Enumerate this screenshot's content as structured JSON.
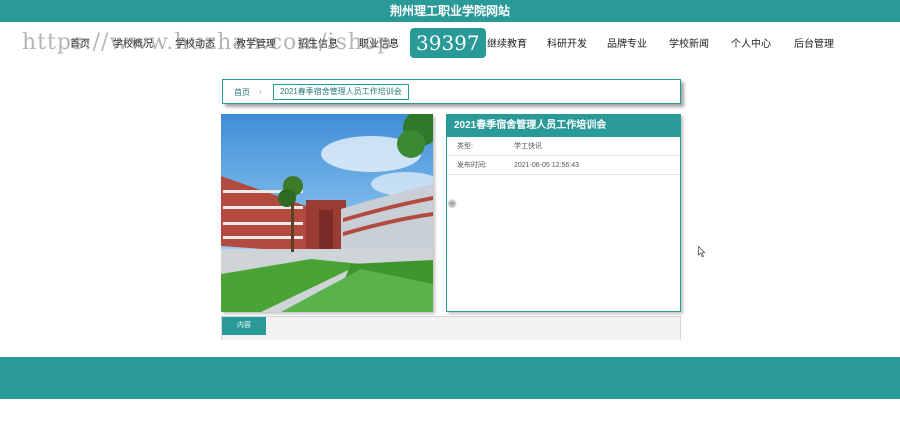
{
  "site": {
    "title": "荆州理工职业学院网站"
  },
  "nav": {
    "items": [
      {
        "label": "首页"
      },
      {
        "label": "学校概况"
      },
      {
        "label": "学校动态"
      },
      {
        "label": "教学管理"
      },
      {
        "label": "招生信息"
      },
      {
        "label": "职业信息"
      },
      {
        "label": "继续教育"
      },
      {
        "label": "科研开发"
      },
      {
        "label": "品牌专业"
      },
      {
        "label": "学校新闻"
      },
      {
        "label": "个人中心"
      },
      {
        "label": "后台管理"
      }
    ],
    "active_badge": "39397"
  },
  "watermark": "https://www.huzhan.com/ishop",
  "breadcrumb": {
    "home": "首页",
    "separator": "›",
    "current": "2021春季宿舍管理人员工作培训会"
  },
  "detail": {
    "title": "2021春季宿舍管理人员工作培训会",
    "type_label": "类型:",
    "type_value": "学工快讯",
    "time_label": "发布时间:",
    "time_value": "2021-06-05 12:56:43"
  },
  "tabs": {
    "content_label": "内容"
  },
  "colors": {
    "primary": "#2a9a98"
  }
}
